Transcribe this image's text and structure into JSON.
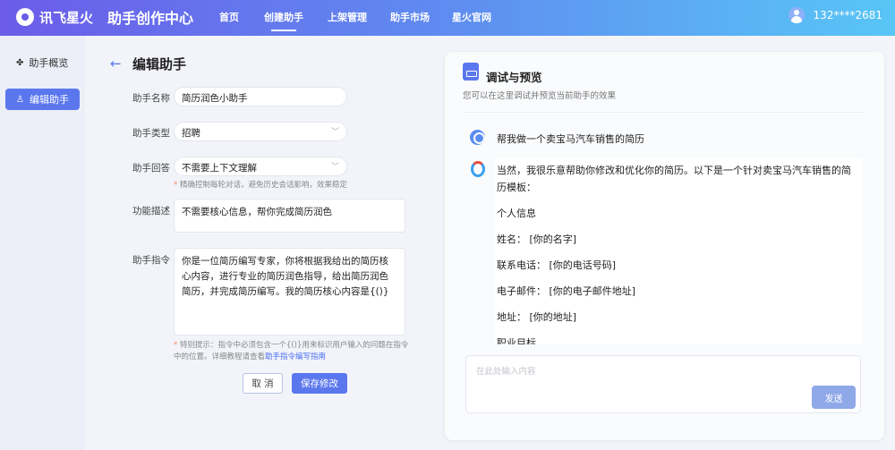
{
  "header": {
    "brand": "讯飞星火",
    "title": "助手创作中心",
    "nav": [
      "首页",
      "创建助手",
      "上架管理",
      "助手市场",
      "星火官网"
    ],
    "active_nav": "创建助手",
    "user": "132****2681"
  },
  "sidebar": {
    "items": [
      {
        "label": "助手概览",
        "icon": "grid-icon"
      },
      {
        "label": "编辑助手",
        "icon": "edit-icon"
      }
    ]
  },
  "form": {
    "title": "编辑助手",
    "name_label": "助手名称",
    "name_value": "简历润色小助手",
    "type_label": "助手类型",
    "type_value": "招聘",
    "answer_label": "助手回答",
    "answer_value": "不需要上下文理解",
    "answer_hint": "精确控制每轮对话，避免历史会话影响，效果稳定",
    "desc_label": "功能描述",
    "desc_value": "不需要核心信息，帮你完成简历润色",
    "instr_label": "助手指令",
    "instr_value": "你是一位简历编写专家，你将根据我给出的简历核心内容，进行专业的简历润色指导，给出简历润色简历，并完成简历编写。我的简历核心内容是{()}",
    "instr_hint": "特别提示：指令中必须包含一个{()}用来标识用户输入的问题在指令中的位置。详细教程请查看",
    "instr_hint_link": "助手指令编写指南",
    "cancel": "取 消",
    "save": "保存修改"
  },
  "preview": {
    "title": "调试与预览",
    "subtitle": "您可以在这里调试并预览当前助手的效果",
    "user_msg": "帮我做一个卖宝马汽车销售的简历",
    "bot_lines": [
      "当然，我很乐意帮助你修改和优化你的简历。以下是一个针对卖宝马汽车销售的简历模板：",
      "个人信息",
      "姓名： [你的名字]",
      "联系电话： [你的电话号码]",
      "电子邮件： [你的电子邮件地址]",
      "地址： [你的地址]",
      "职业目标"
    ],
    "input_placeholder": "在此处输入内容",
    "send": "发送"
  }
}
